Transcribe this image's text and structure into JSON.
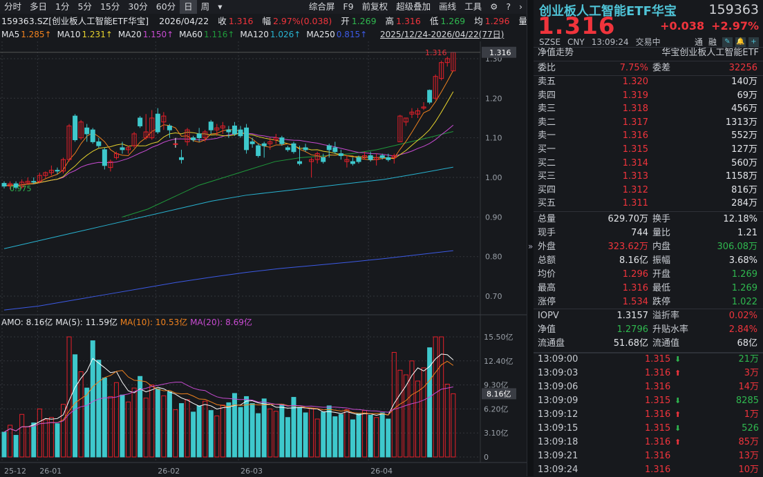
{
  "toolbar": {
    "left": [
      "分时",
      "多日",
      "1分",
      "5分",
      "15分",
      "30分",
      "60分",
      "日",
      "周",
      "▾"
    ],
    "active": "日",
    "right": [
      "综合屏",
      "F9",
      "前复权",
      "超级叠加",
      "画线",
      "工具",
      "⚙",
      "?",
      "›"
    ]
  },
  "info": {
    "symbol": "159363.SZ[创业板人工智能ETF华宝]",
    "date": "2026/04/22",
    "close_label": "收",
    "close": "1.316",
    "amp_label": "幅",
    "amp": "2.97%(0.038)",
    "open_label": "开",
    "open": "1.269",
    "high_label": "高",
    "high": "1.316",
    "low_label": "低",
    "low": "1.269",
    "avg_label": "均",
    "avg": "1.296",
    "more": "量"
  },
  "ma": [
    {
      "label": "MA5",
      "value": "1.285↑",
      "color": "#f0821e"
    },
    {
      "label": "MA10",
      "value": "1.231↑",
      "color": "#e6d22d"
    },
    {
      "label": "MA20",
      "value": "1.150↑",
      "color": "#c84bd2"
    },
    {
      "label": "MA60",
      "value": "1.116↑",
      "color": "#1f9a3b"
    },
    {
      "label": "MA120",
      "value": "1.026↑",
      "color": "#28b4d2"
    },
    {
      "label": "MA250",
      "value": "0.815↑",
      "color": "#3c5ae6"
    }
  ],
  "range": "2025/12/24-2026/04/22(77日)",
  "amo": {
    "amo": "AMO: 8.16亿",
    "ma5": "MA(5): 11.59亿",
    "ma10": "MA(10): 10.53亿",
    "ma20": "MA(20): 8.69亿"
  },
  "colors": {
    "up": "#e8202a",
    "down": "#3ec8cc",
    "bg": "#17191d"
  },
  "chart_data": {
    "type": "candlestick",
    "price_ticks": [
      "1.30",
      "1.20",
      "1.10",
      "1.00",
      "0.90",
      "0.80",
      "0.70"
    ],
    "price_ylim": [
      0.66,
      1.34
    ],
    "last_price": "1.316",
    "low_mark": "0.975",
    "volume_ticks": [
      "15.50亿",
      "12.40亿",
      "9.30亿",
      "6.20亿",
      "3.10亿",
      "0"
    ],
    "volume_ylim": [
      0,
      15.5
    ],
    "last_volume": "8.16亿",
    "date_labels": [
      {
        "i": 0,
        "label": "25-12"
      },
      {
        "i": 6,
        "label": "26-01"
      },
      {
        "i": 26,
        "label": "26-02"
      },
      {
        "i": 40,
        "label": "26-03"
      },
      {
        "i": 62,
        "label": "26-04"
      }
    ],
    "ohlc": [
      [
        0.985,
        0.99,
        0.972,
        0.978
      ],
      [
        0.978,
        0.99,
        0.97,
        0.984
      ],
      [
        0.984,
        0.99,
        0.97,
        0.975
      ],
      [
        0.976,
        0.995,
        0.972,
        0.988
      ],
      [
        0.986,
        1.0,
        0.982,
        0.99
      ],
      [
        0.99,
        1.0,
        0.983,
        0.988
      ],
      [
        0.99,
        1.012,
        0.985,
        1.005
      ],
      [
        1.005,
        1.015,
        0.998,
        1.012
      ],
      [
        1.012,
        1.03,
        1.005,
        1.018
      ],
      [
        1.018,
        1.025,
        1.008,
        1.016
      ],
      [
        1.016,
        1.05,
        1.01,
        1.045
      ],
      [
        1.045,
        1.135,
        1.04,
        1.13
      ],
      [
        1.155,
        1.16,
        1.09,
        1.095
      ],
      [
        1.1,
        1.145,
        1.095,
        1.14
      ],
      [
        1.125,
        1.135,
        1.09,
        1.11
      ],
      [
        1.12,
        1.125,
        1.085,
        1.09
      ],
      [
        1.09,
        1.1,
        1.075,
        1.08
      ],
      [
        1.07,
        1.075,
        1.02,
        1.03
      ],
      [
        1.025,
        1.045,
        1.015,
        1.04
      ],
      [
        1.05,
        1.065,
        1.045,
        1.06
      ],
      [
        1.075,
        1.09,
        1.06,
        1.07
      ],
      [
        1.07,
        1.08,
        1.06,
        1.075
      ],
      [
        1.08,
        1.115,
        1.075,
        1.11
      ],
      [
        1.15,
        1.155,
        1.125,
        1.13
      ],
      [
        1.1,
        1.16,
        1.095,
        1.115
      ],
      [
        1.1,
        1.17,
        1.095,
        1.15
      ],
      [
        1.16,
        1.175,
        1.11,
        1.115
      ],
      [
        1.14,
        1.165,
        1.12,
        1.155
      ],
      [
        1.13,
        1.135,
        1.1,
        1.12
      ],
      [
        1.085,
        1.1,
        1.075,
        1.085
      ],
      [
        1.05,
        1.07,
        1.035,
        1.045
      ],
      [
        1.09,
        1.125,
        1.08,
        1.12
      ],
      [
        1.1,
        1.105,
        1.09,
        1.095
      ],
      [
        1.11,
        1.125,
        1.09,
        1.1
      ],
      [
        1.1,
        1.12,
        1.09,
        1.115
      ],
      [
        1.14,
        1.145,
        1.11,
        1.12
      ],
      [
        1.12,
        1.135,
        1.105,
        1.125
      ],
      [
        1.125,
        1.14,
        1.11,
        1.13
      ],
      [
        1.12,
        1.13,
        1.1,
        1.115
      ],
      [
        1.13,
        1.14,
        1.105,
        1.11
      ],
      [
        1.12,
        1.13,
        1.1,
        1.105
      ],
      [
        1.125,
        1.135,
        1.06,
        1.07
      ],
      [
        1.09,
        1.1,
        1.075,
        1.085
      ],
      [
        1.08,
        1.085,
        1.05,
        1.055
      ],
      [
        1.085,
        1.09,
        1.05,
        1.08
      ],
      [
        1.085,
        1.1,
        1.07,
        1.09
      ],
      [
        1.095,
        1.11,
        1.085,
        1.1
      ],
      [
        1.1,
        1.105,
        1.08,
        1.085
      ],
      [
        1.075,
        1.08,
        1.065,
        1.07
      ],
      [
        1.085,
        1.09,
        1.06,
        1.065
      ],
      [
        1.04,
        1.08,
        1.03,
        1.035
      ],
      [
        1.075,
        1.085,
        1.065,
        1.07
      ],
      [
        1.04,
        1.05,
        1.0,
        1.045
      ],
      [
        1.045,
        1.065,
        1.035,
        1.06
      ],
      [
        1.05,
        1.06,
        1.035,
        1.04
      ],
      [
        1.08,
        1.085,
        1.05,
        1.07
      ],
      [
        1.075,
        1.09,
        1.06,
        1.065
      ],
      [
        1.06,
        1.07,
        1.045,
        1.055
      ],
      [
        1.04,
        1.055,
        1.025,
        1.045
      ],
      [
        1.04,
        1.05,
        1.03,
        1.035
      ],
      [
        1.05,
        1.055,
        1.035,
        1.04
      ],
      [
        1.05,
        1.065,
        1.045,
        1.055
      ],
      [
        1.055,
        1.065,
        1.04,
        1.045
      ],
      [
        1.045,
        1.06,
        1.03,
        1.05
      ],
      [
        1.055,
        1.06,
        1.045,
        1.05
      ],
      [
        1.05,
        1.06,
        1.04,
        1.045
      ],
      [
        1.05,
        1.06,
        1.035,
        1.055
      ],
      [
        1.09,
        1.158,
        1.09,
        1.155
      ],
      [
        1.14,
        1.15,
        1.13,
        1.15
      ],
      [
        1.16,
        1.175,
        1.15,
        1.165
      ],
      [
        1.16,
        1.175,
        1.15,
        1.168
      ],
      [
        1.175,
        1.19,
        1.17,
        1.178
      ],
      [
        1.22,
        1.222,
        1.185,
        1.19
      ],
      [
        1.2,
        1.26,
        1.195,
        1.255
      ],
      [
        1.25,
        1.295,
        1.245,
        1.29
      ],
      [
        1.29,
        1.305,
        1.28,
        1.3
      ],
      [
        1.269,
        1.316,
        1.269,
        1.316
      ]
    ],
    "volume": [
      3.2,
      4.1,
      2.8,
      5.5,
      3.9,
      4.4,
      6.2,
      4.8,
      5.1,
      4.3,
      6.8,
      15.5,
      13.2,
      11.0,
      8.9,
      15.0,
      12.5,
      10.2,
      7.8,
      9.6,
      8.0,
      7.1,
      8.9,
      10.4,
      7.6,
      9.3,
      8.8,
      7.9,
      8.4,
      6.1,
      6.9,
      7.4,
      5.8,
      6.6,
      7.2,
      6.0,
      5.3,
      6.7,
      7.0,
      8.2,
      6.4,
      7.8,
      6.9,
      5.6,
      7.5,
      6.2,
      5.9,
      6.8,
      5.1,
      7.7,
      6.4,
      5.7,
      6.3,
      4.9,
      5.8,
      6.6,
      5.2,
      5.5,
      6.1,
      4.8,
      5.6,
      6.0,
      5.4,
      5.1,
      5.7,
      4.9,
      13.5,
      11.2,
      10.6,
      12.4,
      9.8,
      11.5,
      14.1,
      15.5,
      15.5,
      9.4,
      8.16
    ],
    "ma60": [
      0.9,
      0.92,
      0.95,
      0.98,
      1.0,
      1.02,
      1.04,
      1.05,
      1.055,
      1.06,
      1.07,
      1.085,
      1.1,
      1.116
    ],
    "ma120": [
      0.82,
      0.84,
      0.86,
      0.88,
      0.9,
      0.92,
      0.94,
      0.955,
      0.965,
      0.975,
      0.985,
      0.995,
      1.01,
      1.026
    ],
    "ma250": [
      0.665,
      0.675,
      0.69,
      0.705,
      0.72,
      0.735,
      0.748,
      0.76,
      0.77,
      0.778,
      0.786,
      0.795,
      0.805,
      0.815
    ]
  },
  "right": {
    "title": "创业板人工智能ETF华宝",
    "code": "159363",
    "price": "1.316",
    "change": "+0.038",
    "change_pct": "+2.97%",
    "meta": [
      "SZSE",
      "CNY",
      "13:09:24",
      "交易中"
    ],
    "tags": [
      "通",
      "融"
    ],
    "nav_trend": "净值走势",
    "fund_name": "华宝创业板人工智能ETF",
    "weibi": {
      "l": "委比",
      "v": "7.75%",
      "l2": "委差",
      "v2": "32256"
    },
    "asks": [
      {
        "l": "卖五",
        "p": "1.320",
        "q": "140万"
      },
      {
        "l": "卖四",
        "p": "1.319",
        "q": "69万"
      },
      {
        "l": "卖三",
        "p": "1.318",
        "q": "456万"
      },
      {
        "l": "卖二",
        "p": "1.317",
        "q": "1313万"
      },
      {
        "l": "卖一",
        "p": "1.316",
        "q": "552万"
      }
    ],
    "bids": [
      {
        "l": "买一",
        "p": "1.315",
        "q": "127万"
      },
      {
        "l": "买二",
        "p": "1.314",
        "q": "560万"
      },
      {
        "l": "买三",
        "p": "1.313",
        "q": "1158万"
      },
      {
        "l": "买四",
        "p": "1.312",
        "q": "816万"
      },
      {
        "l": "买五",
        "p": "1.311",
        "q": "284万"
      }
    ],
    "stats": [
      {
        "l": "总量",
        "v": "629.70万",
        "c": "white",
        "l2": "换手",
        "v2": "12.18%",
        "c2": "white"
      },
      {
        "l": "现手",
        "v": "744",
        "c": "white",
        "l2": "量比",
        "v2": "1.21",
        "c2": "white"
      },
      {
        "l": "外盘",
        "v": "323.62万",
        "c": "red",
        "l2": "内盘",
        "v2": "306.08万",
        "c2": "green"
      },
      {
        "l": "总额",
        "v": "8.16亿",
        "c": "white",
        "l2": "振幅",
        "v2": "3.68%",
        "c2": "white"
      },
      {
        "l": "均价",
        "v": "1.296",
        "c": "red",
        "l2": "开盘",
        "v2": "1.269",
        "c2": "green"
      },
      {
        "l": "最高",
        "v": "1.316",
        "c": "red",
        "l2": "最低",
        "v2": "1.269",
        "c2": "green"
      },
      {
        "l": "涨停",
        "v": "1.534",
        "c": "red",
        "l2": "跌停",
        "v2": "1.022",
        "c2": "green"
      }
    ],
    "fund": [
      {
        "l": "IOPV",
        "v": "1.3157",
        "c": "white",
        "l2": "溢折率",
        "v2": "0.02%",
        "c2": "red"
      },
      {
        "l": "净值",
        "v": "1.2796",
        "c": "green",
        "l2": "升贴水率",
        "v2": "2.84%",
        "c2": "red"
      },
      {
        "l": "流通盘",
        "v": "51.68亿",
        "c": "white",
        "l2": "流通值",
        "v2": "68亿",
        "c2": "white"
      }
    ],
    "ticks": [
      {
        "t": "13:09:00",
        "p": "1.315",
        "a": "down",
        "q": "21万",
        "c": "green"
      },
      {
        "t": "13:09:03",
        "p": "1.316",
        "a": "up",
        "q": "3万",
        "c": "red"
      },
      {
        "t": "13:09:06",
        "p": "1.316",
        "a": "",
        "q": "14万",
        "c": "red"
      },
      {
        "t": "13:09:09",
        "p": "1.315",
        "a": "down",
        "q": "8285",
        "c": "green"
      },
      {
        "t": "13:09:12",
        "p": "1.316",
        "a": "up",
        "q": "1万",
        "c": "red"
      },
      {
        "t": "13:09:15",
        "p": "1.315",
        "a": "down",
        "q": "526",
        "c": "green"
      },
      {
        "t": "13:09:18",
        "p": "1.316",
        "a": "up",
        "q": "85万",
        "c": "red"
      },
      {
        "t": "13:09:21",
        "p": "1.316",
        "a": "",
        "q": "13万",
        "c": "red"
      },
      {
        "t": "13:09:24",
        "p": "1.316",
        "a": "",
        "q": "10万",
        "c": "red"
      }
    ]
  }
}
